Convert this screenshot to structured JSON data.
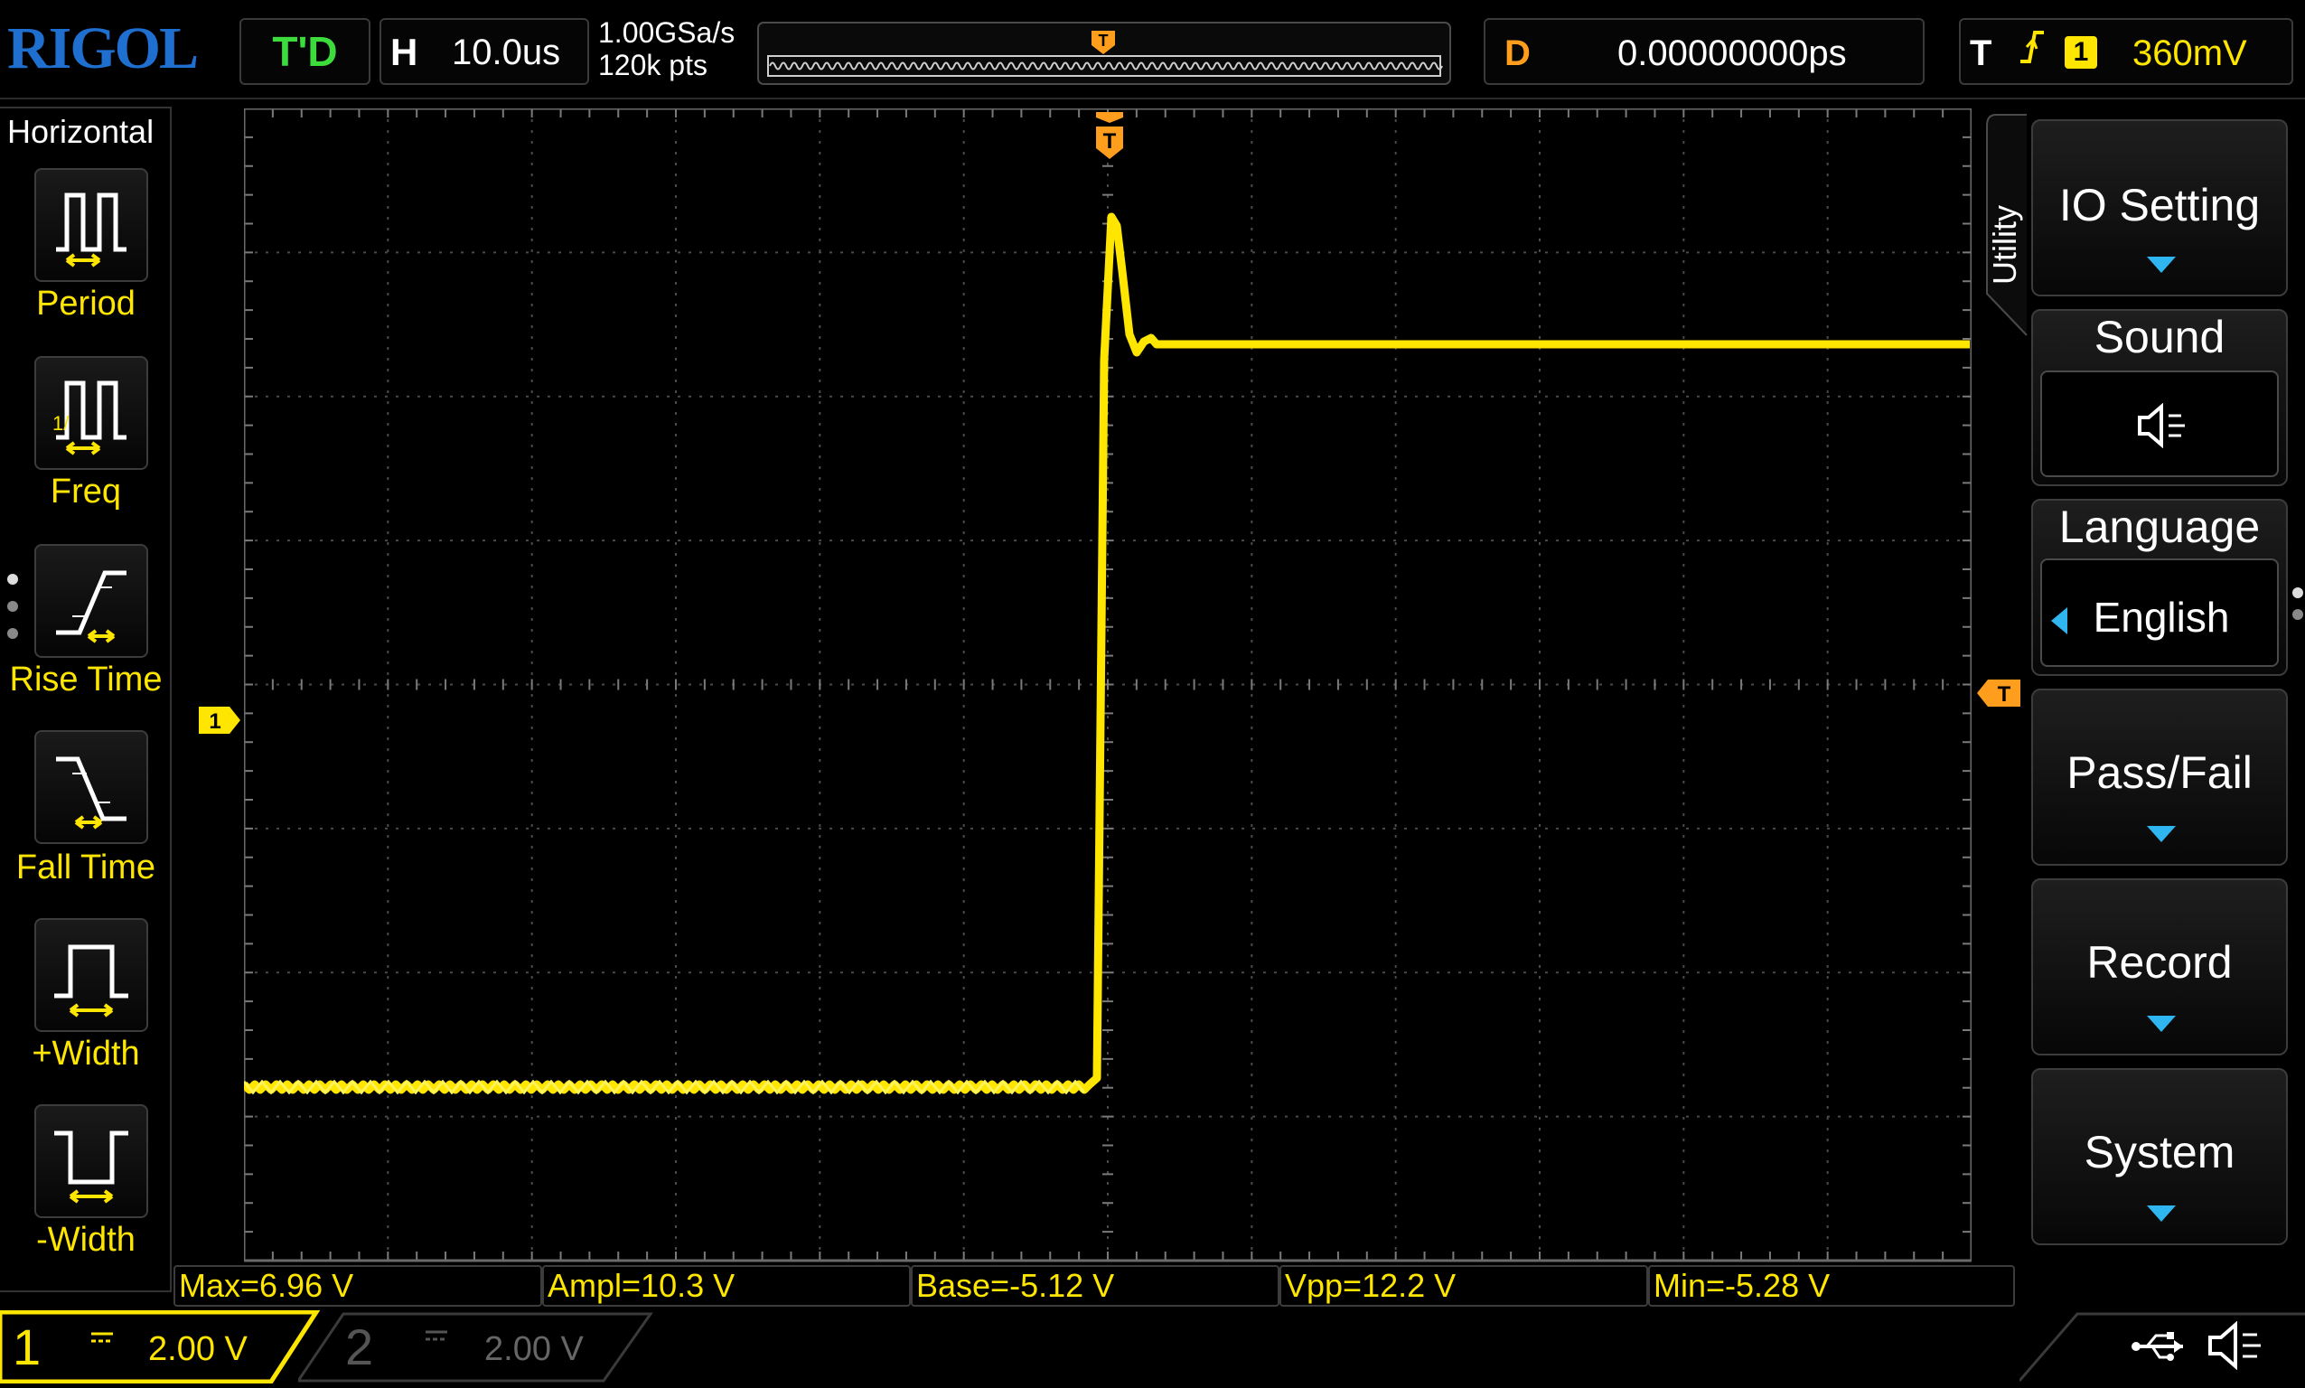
{
  "brand": "RIGOL",
  "header": {
    "run_state": "T'D",
    "horizontal_label": "H",
    "timebase": "10.0us",
    "sample_rate": "1.00GSa/s",
    "memory_depth": "120k pts",
    "trigger_marker": "T",
    "delay_label": "D",
    "delay_value": "0.00000000ps",
    "trigger_label": "T",
    "trigger_slope": "rising-edge-icon",
    "trigger_source": "1",
    "trigger_level": "360mV"
  },
  "left_menu": {
    "title": "Horizontal",
    "items": [
      {
        "label": "Period",
        "icon": "period-icon"
      },
      {
        "label": "Freq",
        "icon": "frequency-icon"
      },
      {
        "label": "Rise Time",
        "icon": "rise-time-icon"
      },
      {
        "label": "Fall Time",
        "icon": "fall-time-icon"
      },
      {
        "label": "+Width",
        "icon": "positive-width-icon"
      },
      {
        "label": "-Width",
        "icon": "negative-width-icon"
      }
    ]
  },
  "screen": {
    "ch1_marker": "1",
    "trigger_level_marker": "T",
    "trigger_pos_marker": "T",
    "waveform_color": "#ffe600",
    "grid_divisions": {
      "horizontal": 12,
      "vertical": 8
    }
  },
  "right_menu": {
    "tab": "Utility",
    "items": [
      {
        "label": "IO Setting",
        "has_submenu": true
      },
      {
        "label": "Sound",
        "value_icon": "speaker-muted-icon"
      },
      {
        "label": "Language",
        "value": "English"
      },
      {
        "label": "Pass/Fail",
        "has_submenu": true
      },
      {
        "label": "Record",
        "has_submenu": true
      },
      {
        "label": "System",
        "has_submenu": true
      }
    ]
  },
  "measurements": [
    "Max=6.96 V",
    "Ampl=10.3 V",
    "Base=-5.12 V",
    "Vpp=12.2 V",
    "Min=-5.28 V"
  ],
  "channels": [
    {
      "number": "1",
      "coupling": "DC",
      "scale": "2.00 V",
      "active": true,
      "color": "#ffe600"
    },
    {
      "number": "2",
      "coupling": "DC",
      "scale": "2.00 V",
      "active": false,
      "color": "#555555"
    }
  ],
  "status_icons": [
    "usb-icon",
    "speaker-muted-icon"
  ]
}
